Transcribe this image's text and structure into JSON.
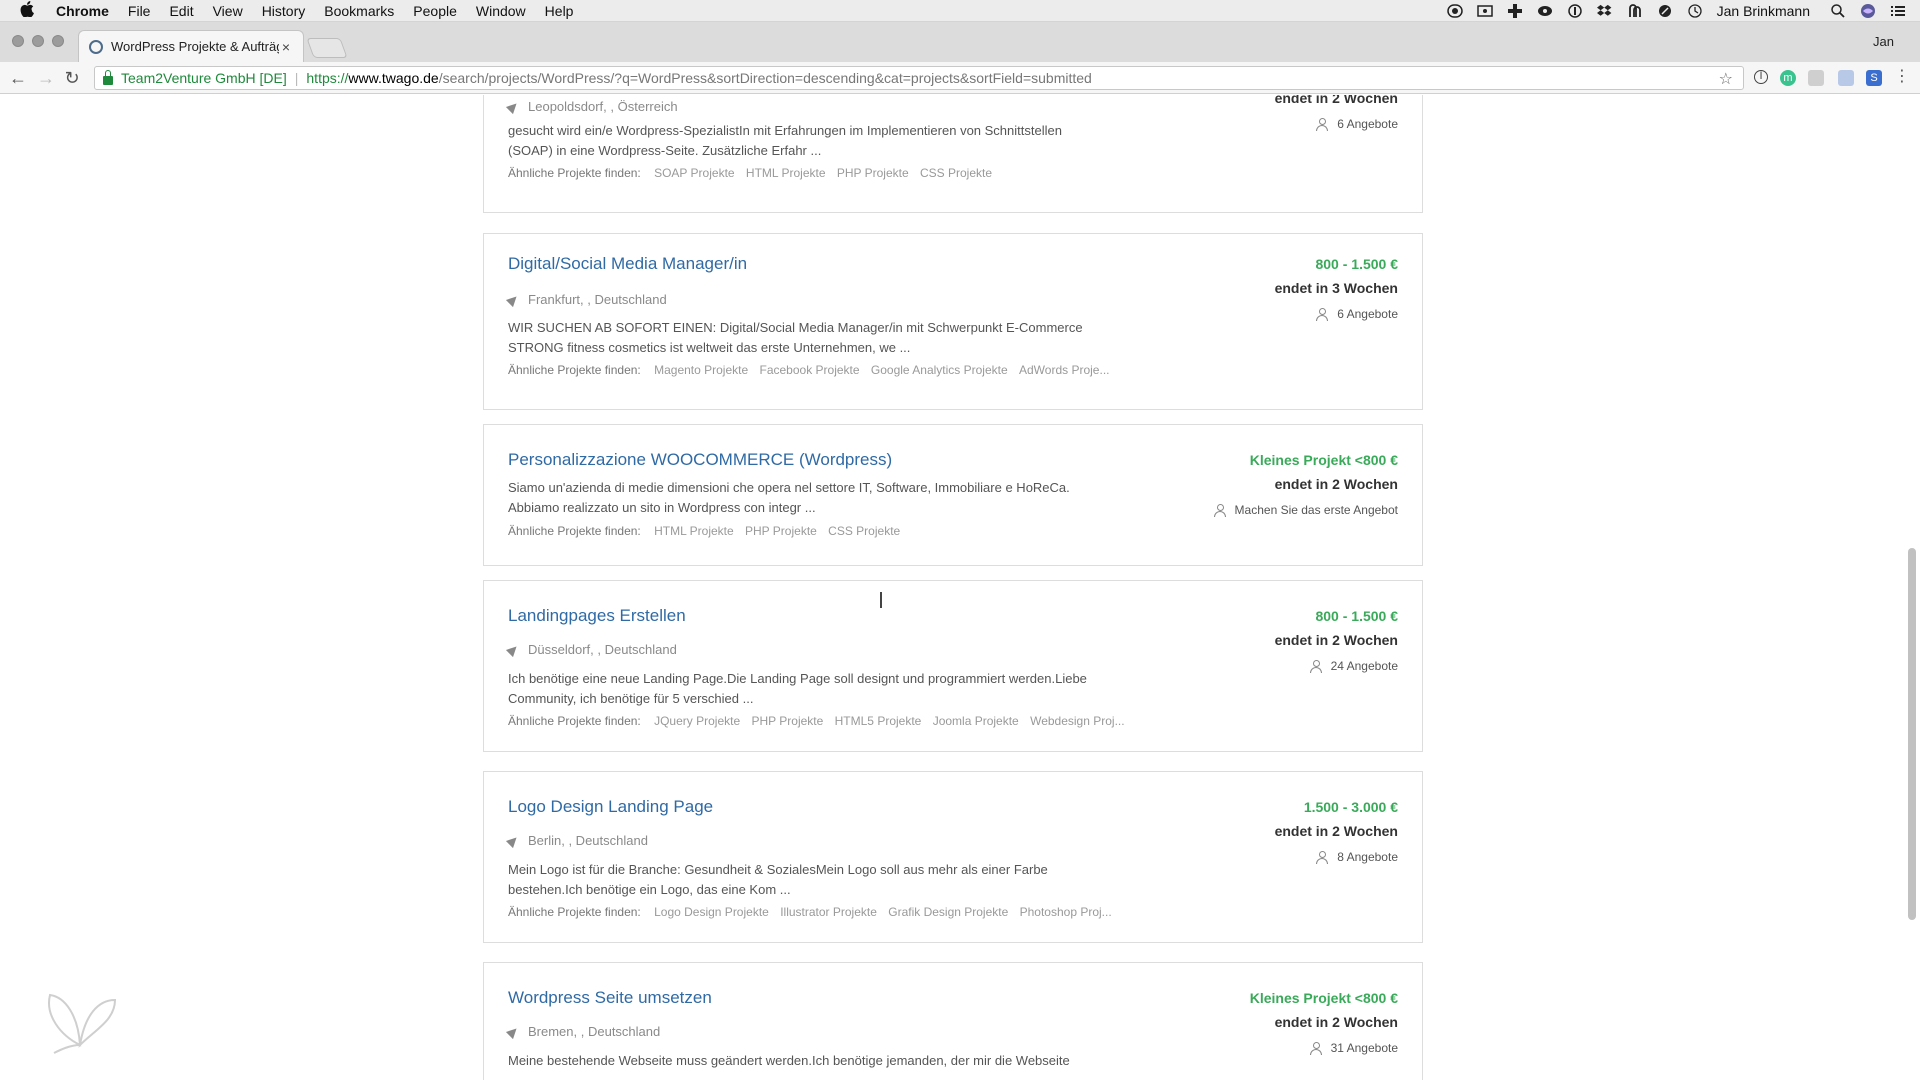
{
  "menubar": {
    "apple": "",
    "items": [
      "Chrome",
      "File",
      "Edit",
      "View",
      "History",
      "Bookmarks",
      "People",
      "Window",
      "Help"
    ],
    "user": "Jan Brinkmann"
  },
  "tabstrip": {
    "tab_title": "WordPress Projekte & Aufträge",
    "tab_close": "×",
    "profile": "Jan"
  },
  "toolbar": {
    "org": "Team2Venture GmbH [DE]",
    "url_scheme": "https://",
    "url_host": "www.twago.de",
    "url_path": "/search/projects/WordPress/?q=WordPress&sortDirection=descending&cat=projects&sortField=submitted",
    "back": "←",
    "forward": "→",
    "reload": "↻",
    "star": "☆",
    "ext_m": "m",
    "ext_s": "S"
  },
  "similar_label": "Ähnliche Projekte finden:",
  "projects": [
    {
      "title": "",
      "location": "Leopoldsdorf, , Österreich",
      "description": "gesucht wird ein/e Wordpress-SpezialistIn mit Erfahrungen im Implementieren von Schnittstellen (SOAP) in eine Wordpress-Seite. Zusätzliche Erfahr ...",
      "tags": [
        "SOAP Projekte",
        "HTML Projekte",
        "PHP Projekte",
        "CSS Projekte"
      ],
      "price": "",
      "ends": "endet  in 2 Wochen",
      "offers": "6 Angebote"
    },
    {
      "title": "Digital/Social Media Manager/in",
      "location": "Frankfurt, , Deutschland",
      "description": "WIR SUCHEN AB SOFORT EINEN: Digital/Social Media Manager/in mit Schwerpunkt E-Commerce STRONG fitness cosmetics ist weltweit das erste Unternehmen, we ...",
      "tags": [
        "Magento Projekte",
        "Facebook Projekte",
        "Google Analytics Projekte",
        "AdWords Proje..."
      ],
      "price": "800 - 1.500 €",
      "ends": "endet  in 3 Wochen",
      "offers": "6 Angebote"
    },
    {
      "title": "Personalizzazione WOOCOMMERCE (Wordpress)",
      "location": "",
      "description": "Siamo un'azienda di medie dimensioni che opera nel settore IT, Software, Immobiliare e HoReCa. Abbiamo realizzato un sito in Wordpress con integr ...",
      "tags": [
        "HTML Projekte",
        "PHP Projekte",
        "CSS Projekte"
      ],
      "price": "Kleines Projekt <800 €",
      "ends": "endet  in 2 Wochen",
      "offers": "Machen Sie das erste Angebot"
    },
    {
      "title": "Landingpages Erstellen",
      "location": "Düsseldorf, , Deutschland",
      "description": "Ich benötige eine neue Landing Page.Die Landing Page soll designt und programmiert werden.Liebe Community, ich benötige für 5 verschied ...",
      "tags": [
        "JQuery Projekte",
        "PHP Projekte",
        "HTML5 Projekte",
        "Joomla Projekte",
        "Webdesign Proj..."
      ],
      "price": "800 - 1.500 €",
      "ends": "endet  in 2 Wochen",
      "offers": "24 Angebote"
    },
    {
      "title": "Logo Design Landing Page",
      "location": "Berlin, , Deutschland",
      "description": "Mein Logo ist für die Branche: Gesundheit & SozialesMein Logo soll aus mehr als einer Farbe bestehen.Ich benötige ein Logo, das eine Kom ...",
      "tags": [
        "Logo Design Projekte",
        "Illustrator Projekte",
        "Grafik Design Projekte",
        "Photoshop Proj..."
      ],
      "price": "1.500 - 3.000 €",
      "ends": "endet  in 2 Wochen",
      "offers": "8 Angebote"
    },
    {
      "title": "Wordpress Seite umsetzen",
      "location": "Bremen, , Deutschland",
      "description": "Meine bestehende Webseite muss geändert werden.Ich benötige jemanden, der mir die Webseite",
      "tags": [],
      "price": "Kleines Projekt <800 €",
      "ends": "endet  in 2 Wochen",
      "offers": "31 Angebote"
    }
  ]
}
